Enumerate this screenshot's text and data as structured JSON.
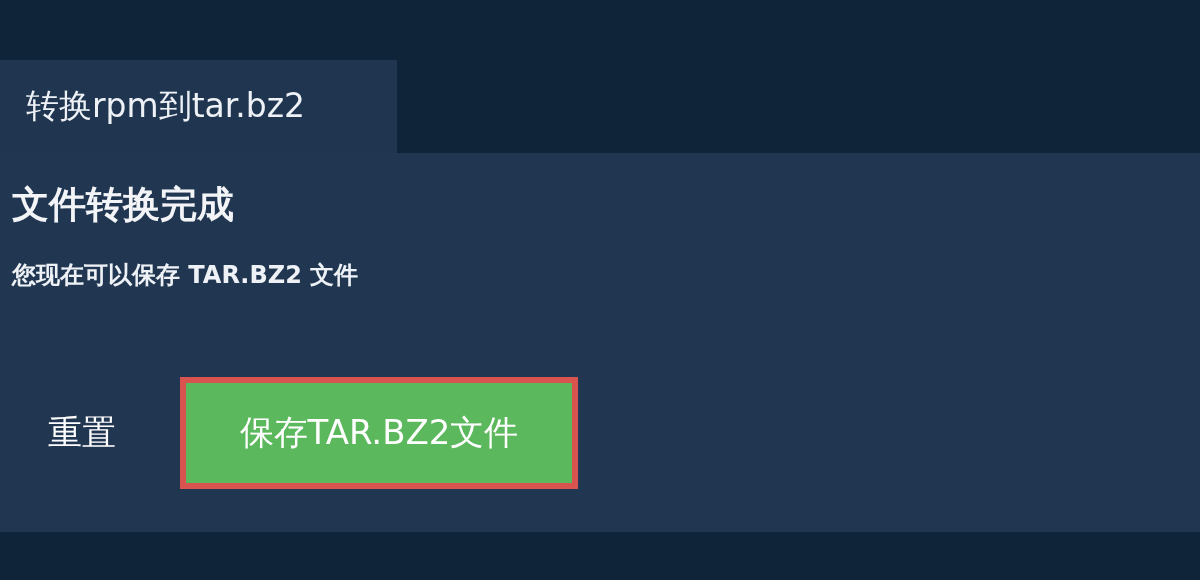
{
  "tab": {
    "label": "转换rpm到tar.bz2",
    "selected": true
  },
  "panel": {
    "title": "文件转换完成",
    "message": "您现在可以保存 TAR.BZ2 文件"
  },
  "buttons": [
    {
      "label": "重置",
      "kind": "plain"
    },
    {
      "label": "保存TAR.BZ2文件",
      "kind": "primary"
    }
  ]
}
